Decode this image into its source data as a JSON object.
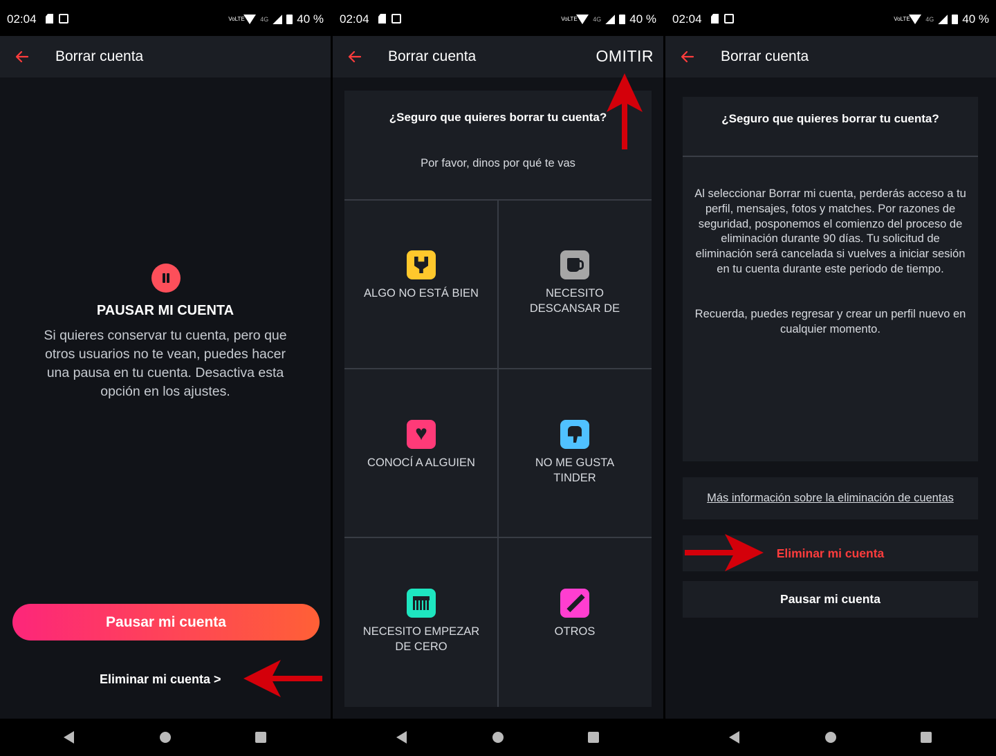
{
  "status_bar": {
    "time": "02:04",
    "lte": "VoLTE",
    "network": "4G",
    "battery": "40 %"
  },
  "panel1": {
    "title": "Borrar cuenta",
    "pause_heading": "PAUSAR MI CUENTA",
    "pause_description": "Si quieres conservar tu cuenta, pero que otros usuarios no te vean, puedes hacer una pausa en tu cuenta. Desactiva esta opción en los ajustes.",
    "pause_button": "Pausar mi cuenta",
    "delete_link": "Eliminar mi cuenta >"
  },
  "panel2": {
    "title": "Borrar cuenta",
    "skip": "OMITIR",
    "question": "¿Seguro que quieres borrar tu cuenta?",
    "subtitle": "Por favor, dinos por qué te vas",
    "reasons": [
      {
        "label": "ALGO NO ESTÁ BIEN",
        "icon": "wrench-icon",
        "color": "#ffc82c"
      },
      {
        "label": "NECESITO DESCANSAR DE",
        "icon": "cup-icon",
        "color": "#a6a6a6"
      },
      {
        "label": "CONOCÍ A ALGUIEN",
        "icon": "heart-icon",
        "color": "#ff3a78"
      },
      {
        "label": "NO ME GUSTA TINDER",
        "icon": "thumbs-down-icon",
        "color": "#50c1ff"
      },
      {
        "label": "NECESITO EMPEZAR DE CERO",
        "icon": "broom-icon",
        "color": "#1ee6c0"
      },
      {
        "label": "OTROS",
        "icon": "pencil-icon",
        "color": "#ff3ed0"
      }
    ]
  },
  "panel3": {
    "title": "Borrar cuenta",
    "question": "¿Seguro que quieres borrar tu cuenta?",
    "body": "Al seleccionar Borrar mi cuenta, perderás acceso a tu perfil, mensajes, fotos y matches. Por razones de seguridad, posponemos el comienzo del proceso de eliminación durante 90 días. Tu solicitud de eliminación será cancelada si vuelves a iniciar sesión en tu cuenta durante este periodo de tiempo.",
    "body2": "Recuerda, puedes regresar y crear un perfil nuevo en cualquier momento.",
    "info_link": "Más información sobre la eliminación de cuentas",
    "delete_button": "Eliminar mi cuenta",
    "pause_button": "Pausar mi cuenta"
  },
  "colors": {
    "accent_red": "#fe3c3c",
    "gradient_start": "#fd267a",
    "gradient_end": "#ff6036",
    "annotation_arrow": "#d4000a"
  }
}
